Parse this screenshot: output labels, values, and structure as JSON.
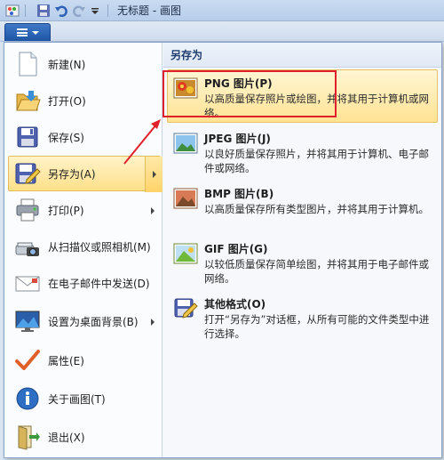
{
  "titlebar": {
    "title": "无标题 - 画图"
  },
  "quick_access": [
    "save-icon",
    "undo-icon",
    "redo-icon",
    "dropdown-icon"
  ],
  "left_menu": [
    {
      "label": "新建(N)",
      "icon": "new-document-icon"
    },
    {
      "label": "打开(O)",
      "icon": "open-folder-icon"
    },
    {
      "label": "保存(S)",
      "icon": "save-icon"
    },
    {
      "label": "另存为(A)",
      "icon": "save-as-icon",
      "has_submenu": true,
      "active": true
    },
    {
      "label": "打印(P)",
      "icon": "print-icon",
      "has_submenu": true
    },
    {
      "label": "从扫描仪或照相机(M)",
      "icon": "scanner-icon"
    },
    {
      "label": "在电子邮件中发送(D)",
      "icon": "email-icon"
    },
    {
      "label": "设置为桌面背景(B)",
      "icon": "desktop-background-icon",
      "has_submenu": true
    },
    {
      "label": "属性(E)",
      "icon": "properties-check-icon"
    },
    {
      "label": "关于画图(T)",
      "icon": "info-icon"
    },
    {
      "label": "退出(X)",
      "icon": "exit-icon"
    }
  ],
  "submenu": {
    "header": "另存为",
    "items": [
      {
        "title": "PNG 图片(P)",
        "desc": "以高质量保存照片或绘图，并将其用于计算机或网络。",
        "icon": "png-image-icon",
        "active": true
      },
      {
        "title": "JPEG 图片(J)",
        "desc": "以良好质量保存照片，并将其用于计算机、电子邮件或网络。",
        "icon": "jpeg-image-icon"
      },
      {
        "title": "BMP 图片(B)",
        "desc": "以高质量保存所有类型图片，并将其用于计算机。",
        "icon": "bmp-image-icon"
      },
      {
        "title": "GIF 图片(G)",
        "desc": "以较低质量保存简单绘图，并将其用于电子邮件或网络。",
        "icon": "gif-image-icon"
      },
      {
        "title": "其他格式(O)",
        "desc": "打开“另存为”对话框，从所有可能的文件类型中进行选择。",
        "icon": "other-formats-icon"
      }
    ]
  },
  "colors": {
    "highlight": "#ffe08a",
    "annotation_red": "#e0202a",
    "app_button": "#1e56a6"
  }
}
